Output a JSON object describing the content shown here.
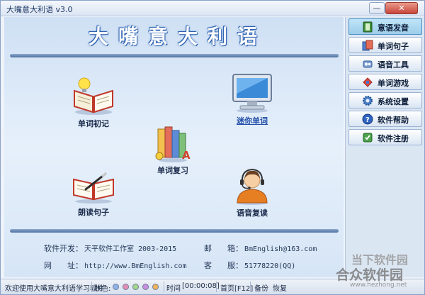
{
  "window": {
    "title": "大嘴意大利语 v3.0",
    "minimize_glyph": "—",
    "close_glyph": "✕"
  },
  "banner": {
    "title": "大嘴意大利语"
  },
  "features": [
    {
      "label": "单词初记",
      "icon": "book-lightbulb-icon"
    },
    {
      "label": "迷你单词",
      "icon": "monitor-icon"
    },
    {
      "label": "单词复习",
      "icon": "books-stack-icon"
    },
    {
      "label": "朗读句子",
      "icon": "open-book-pen-icon"
    },
    {
      "label": "语音复读",
      "icon": "headset-person-icon"
    }
  ],
  "info": {
    "developer_label": "软件开发：",
    "developer_value": "天平软件工作室 2003-2015",
    "email_label": "邮　　箱：",
    "email_value": "BmEnglish@163.com",
    "website_label": "网　　址：",
    "website_value": "http://www.BmEnglish.com",
    "service_label": "客　　服：",
    "service_value": "51778220(QQ)"
  },
  "sidebar": {
    "items": [
      {
        "label": "意语发音",
        "icon": "pronunciation-book-icon",
        "active": true
      },
      {
        "label": "单词句子",
        "icon": "word-sentence-icon",
        "active": false
      },
      {
        "label": "语音工具",
        "icon": "voice-tool-icon",
        "active": false
      },
      {
        "label": "单词游戏",
        "icon": "word-game-icon",
        "active": false
      },
      {
        "label": "系统设置",
        "icon": "settings-gear-icon",
        "active": false
      },
      {
        "label": "软件帮助",
        "icon": "help-question-icon",
        "active": false
      },
      {
        "label": "软件注册",
        "icon": "register-icon",
        "active": false
      }
    ]
  },
  "statusbar": {
    "welcome": "欢迎使用大嘴意大利语学习软件",
    "skin_label": "肤色:",
    "skin_colors": [
      "#8fb3e6",
      "#e38fb8",
      "#a4d78a",
      "#c88fe0",
      "#f0b35a"
    ],
    "time_label": "时间",
    "time_value": "[00:00:08]",
    "home_label": "首页[F12]",
    "backup_label": "备份",
    "restore_label": "恢复"
  },
  "watermark": {
    "line1": "当下软件园",
    "line2": "合众软件园",
    "line3": "www.hezhong.net"
  },
  "colors": {
    "accent": "#2d62b0",
    "sidebar_active": "#9ccde9",
    "link": "#1f4ca8"
  }
}
